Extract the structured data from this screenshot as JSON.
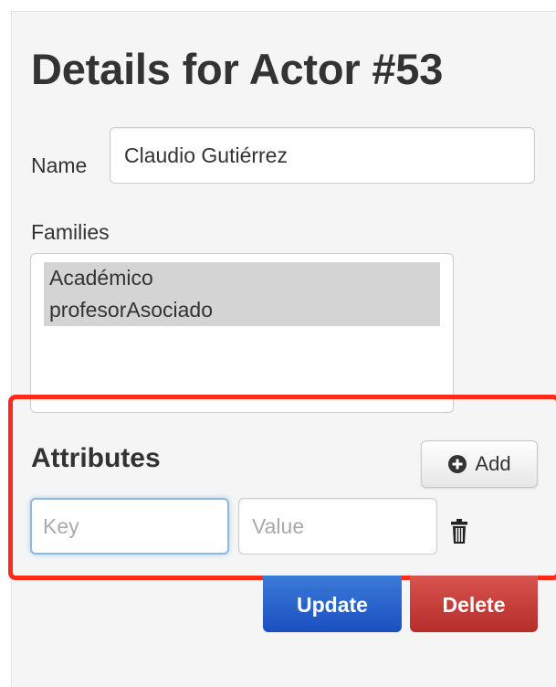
{
  "page": {
    "title": "Details for Actor #53"
  },
  "form": {
    "name_label": "Name",
    "name_value": "Claudio Gutiérrez",
    "families_label": "Families",
    "families": [
      "Académico",
      "profesorAsociado"
    ]
  },
  "attributes": {
    "heading": "Attributes",
    "add_label": "Add",
    "key_placeholder": "Key",
    "value_placeholder": "Value"
  },
  "actions": {
    "update_label": "Update",
    "delete_label": "Delete"
  },
  "colors": {
    "highlight": "#ff2a1a",
    "primary": "#1a4fbf",
    "danger": "#b32e2a"
  },
  "icons": {
    "add": "plus-circle-icon",
    "remove": "trash-icon"
  }
}
